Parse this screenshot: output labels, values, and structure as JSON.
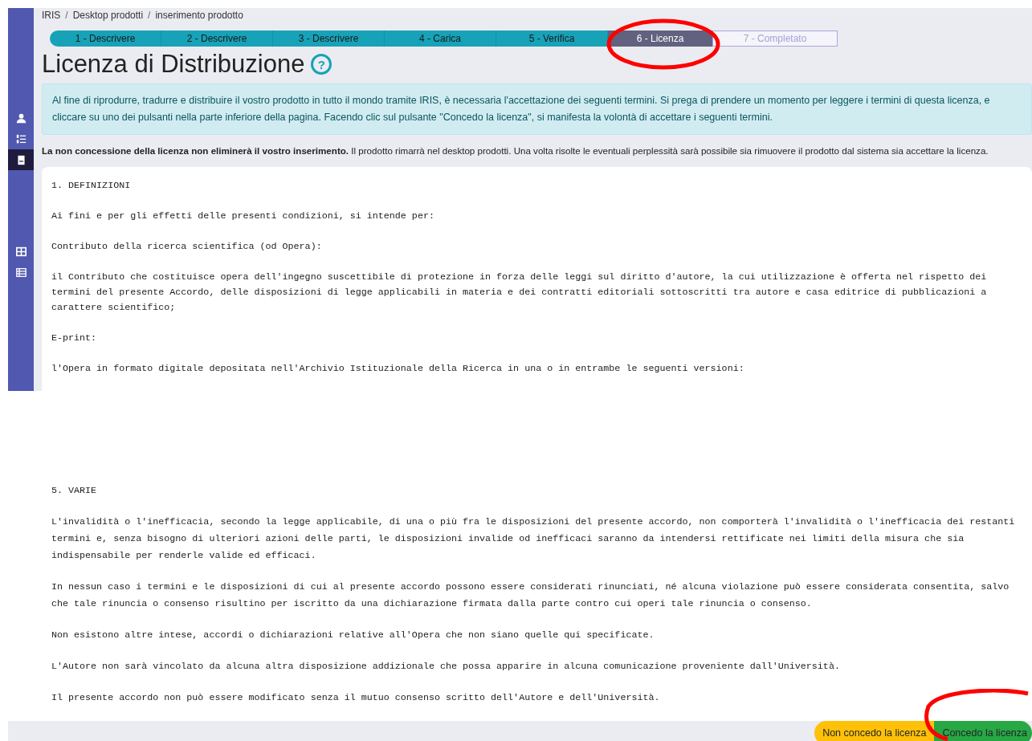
{
  "breadcrumb": [
    {
      "label": "IRIS"
    },
    {
      "separator": "/",
      "label": "Desktop prodotti"
    },
    {
      "separator": "/",
      "label": "inserimento prodotto"
    }
  ],
  "sidebar": {
    "items": [
      {
        "selected": false
      },
      {
        "selected": false
      },
      {
        "selected": true
      },
      {
        "selected": false
      },
      {
        "selected": false
      }
    ]
  },
  "steps": [
    {
      "label": "1 - Descrivere",
      "selected": false,
      "disabled": false
    },
    {
      "label": "2 - Descrivere",
      "selected": false,
      "disabled": false
    },
    {
      "label": "3 - Descrivere",
      "selected": false,
      "disabled": false
    },
    {
      "label": "4 - Carica",
      "selected": false,
      "disabled": false
    },
    {
      "label": "5 - Verifica",
      "selected": false,
      "disabled": false
    },
    {
      "label": "6 - Licenza",
      "selected": true,
      "disabled": false
    },
    {
      "label": "7 - Completato",
      "selected": false,
      "disabled": true
    }
  ],
  "title": "Licenza di Distribuzione",
  "help_icon": "?",
  "info_alert": "Al fine di riprodurre, tradurre e distribuire il vostro prodotto in tutto il mondo tramite IRIS, è necessaria l'accettazione dei seguenti termini. Si prega di prendere un momento per leggere i termini di questa licenza, e cliccare su uno dei pulsanti nella parte inferiore della pagina. Facendo clic sul pulsante \"Concedo la licenza\", si manifesta la volontà di accettare i seguenti termini.",
  "notice": "**La non concessione della licenza non eliminerà il vostro inserimento.** Il prodotto rimarrà nel desktop prodotti. Una volta risolte le eventuali perplessità sarà possibile sia rimuovere il prodotto dal sistema sia accettare la licenza.",
  "license_text_top": [
    "1. DEFINIZIONI",
    "Ai fini e per gli effetti delle presenti condizioni, si intende per:",
    "Contributo della ricerca scientifica (od Opera):",
    "il Contributo che costituisce opera dell'ingegno suscettibile di protezione in forza delle leggi sul diritto d'autore, la cui utilizzazione è offerta nel rispetto dei termini del presente Accordo, delle disposizioni di legge applicabili in materia e dei contratti editoriali sottoscritti tra autore e casa editrice di pubblicazioni a carattere scientifico;",
    "E-print:",
    "l'Opera in formato digitale depositata nell'Archivio Istituzionale della Ricerca in una o in entrambe le seguenti versioni:"
  ],
  "license_text_bottom": [
    "5. VARIE",
    "L'invalidità o l'inefficacia, secondo la legge applicabile, di una o più fra le disposizioni del presente accordo, non comporterà l'invalidità o l'inefficacia dei restanti termini e, senza bisogno di ulteriori azioni delle parti, le disposizioni invalide od inefficaci saranno da intendersi rettificate nei limiti della misura che sia indispensabile per renderle valide ed efficaci.",
    "In nessun caso i termini e le disposizioni di cui al presente accordo possono essere considerati rinunciati, né alcuna violazione può essere considerata consentita, salvo che tale rinuncia o consenso risultino per iscritto da una dichiarazione firmata dalla parte contro cui operi tale rinuncia o consenso.",
    "Non esistono altre intese, accordi o dichiarazioni relative all'Opera che non siano quelle qui specificate.",
    "L'Autore non sarà vincolato da alcuna altra disposizione addizionale che possa apparire in alcuna comunicazione proveniente dall'Università.",
    "Il presente accordo non può essere modificato senza il mutuo consenso scritto dell'Autore e dell'Università."
  ],
  "buttons": [
    {
      "label": "Non concedo la licenza",
      "kind": "decline"
    },
    {
      "label": "Concedo la licenza",
      "kind": "accept"
    }
  ]
}
